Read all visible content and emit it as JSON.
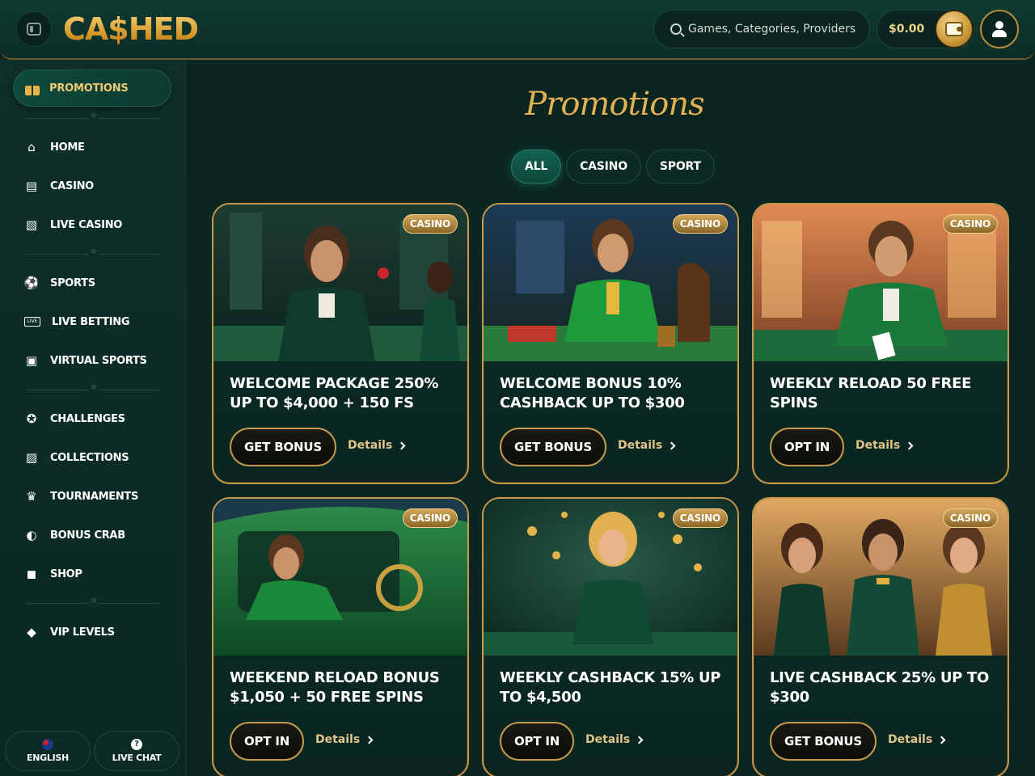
{
  "header": {
    "logo": "CA$HED",
    "search_placeholder": "Games, Categories, Providers",
    "balance": "$0.00"
  },
  "sidebar": {
    "promotions_label": "PROMOTIONS",
    "items": [
      {
        "label": "HOME",
        "icon": "home-icon"
      },
      {
        "label": "CASINO",
        "icon": "slot-machine-icon"
      },
      {
        "label": "LIVE CASINO",
        "icon": "live-cards-icon"
      },
      {
        "label": "SPORTS",
        "icon": "soccer-ball-icon"
      },
      {
        "label": "LIVE BETTING",
        "icon": "live-badge-icon"
      },
      {
        "label": "VIRTUAL SPORTS",
        "icon": "virtual-screen-icon"
      },
      {
        "label": "CHALLENGES",
        "icon": "medal-icon"
      },
      {
        "label": "COLLECTIONS",
        "icon": "cards-collection-icon"
      },
      {
        "label": "TOURNAMENTS",
        "icon": "trophy-icon"
      },
      {
        "label": "BONUS CRAB",
        "icon": "claw-icon"
      },
      {
        "label": "SHOP",
        "icon": "shopping-bag-icon"
      },
      {
        "label": "VIP LEVELS",
        "icon": "diamond-icon"
      }
    ],
    "language_label": "ENGLISH",
    "chat_label": "LIVE CHAT"
  },
  "main": {
    "title": "Promotions",
    "tabs": [
      "ALL",
      "CASINO",
      "SPORT"
    ],
    "active_tab": "ALL",
    "details_label": "Details",
    "cards": [
      {
        "badge": "CASINO",
        "title": "WELCOME PACKAGE 250% UP TO $4,000 + 150 FS",
        "cta": "GET BONUS"
      },
      {
        "badge": "CASINO",
        "title": "WELCOME BONUS 10% CASHBACK UP TO $300",
        "cta": "GET BONUS"
      },
      {
        "badge": "CASINO",
        "title": "WEEKLY RELOAD 50 FREE SPINS",
        "cta": "OPT IN"
      },
      {
        "badge": "CASINO",
        "title": "WEEKEND RELOAD BONUS $1,050 + 50 FREE SPINS",
        "cta": "OPT IN"
      },
      {
        "badge": "CASINO",
        "title": "WEEKLY CASHBACK 15% UP TO $4,500",
        "cta": "OPT IN"
      },
      {
        "badge": "CASINO",
        "title": "LIVE CASHBACK 25% UP TO $300",
        "cta": "GET BONUS"
      }
    ]
  },
  "colors": {
    "background": "#0b2621",
    "gold": "#c49a4e",
    "accent_green": "#146252"
  }
}
